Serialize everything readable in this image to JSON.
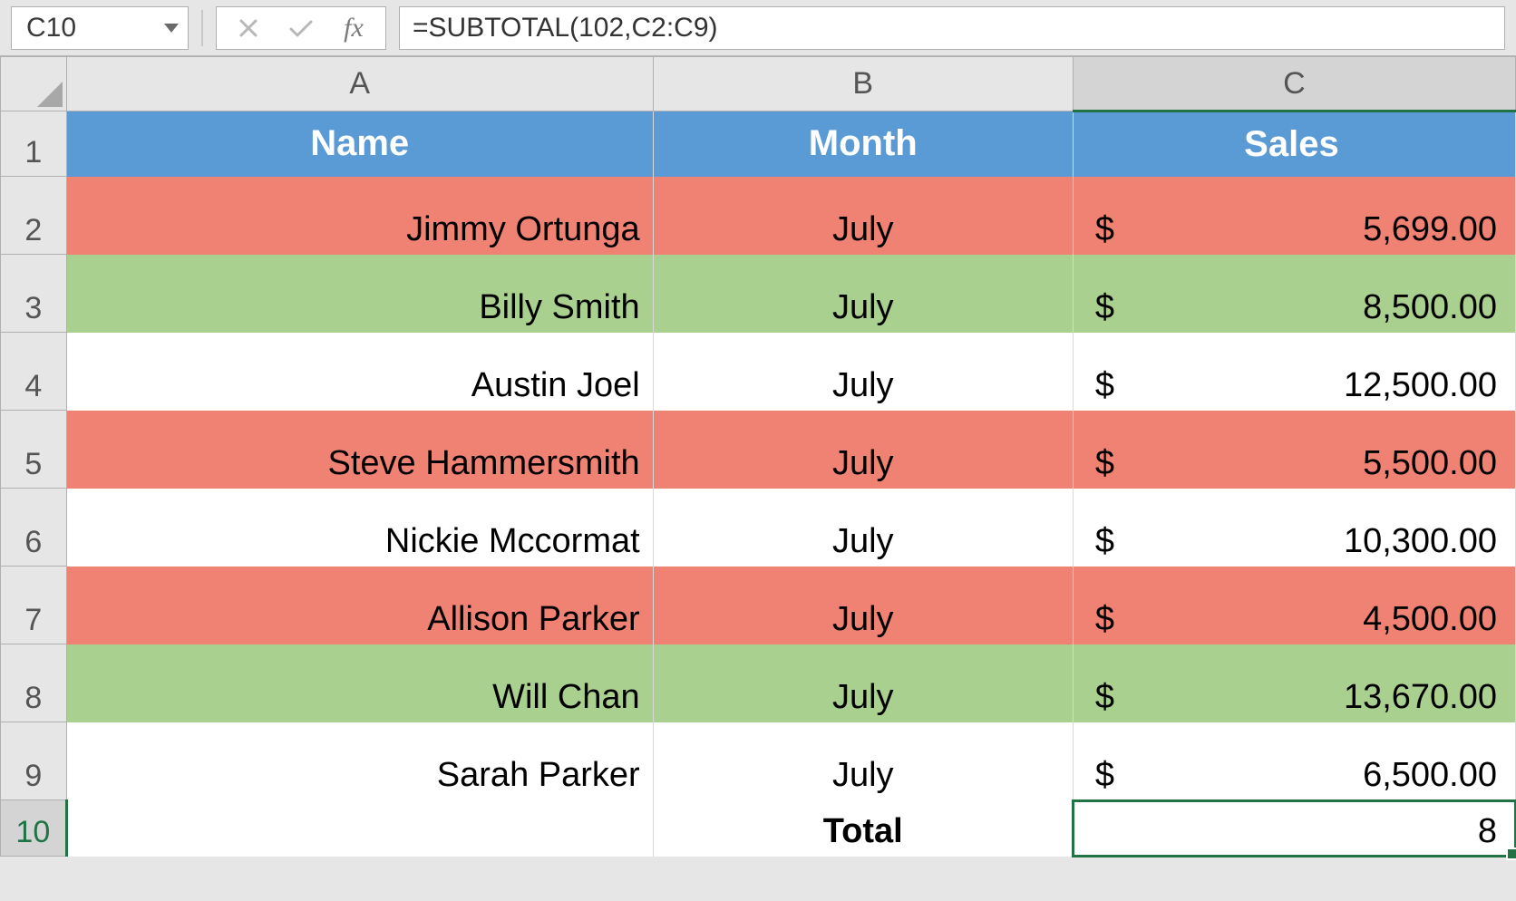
{
  "namebox": {
    "ref": "C10"
  },
  "formula_bar": {
    "fx_label": "fx",
    "formula": "=SUBTOTAL(102,C2:C9)"
  },
  "columns": [
    "A",
    "B",
    "C"
  ],
  "row_numbers": [
    "1",
    "2",
    "3",
    "4",
    "5",
    "6",
    "7",
    "8",
    "9",
    "10"
  ],
  "selected_cell": "C10",
  "table": {
    "headers": {
      "name": "Name",
      "month": "Month",
      "sales": "Sales"
    },
    "rows": [
      {
        "n": "2",
        "name": "Jimmy Ortunga",
        "month": "July",
        "sales": "5,699.00",
        "fill": "red"
      },
      {
        "n": "3",
        "name": "Billy Smith",
        "month": "July",
        "sales": "8,500.00",
        "fill": "green"
      },
      {
        "n": "4",
        "name": "Austin Joel",
        "month": "July",
        "sales": "12,500.00",
        "fill": "white"
      },
      {
        "n": "5",
        "name": "Steve Hammersmith",
        "month": "July",
        "sales": "5,500.00",
        "fill": "red"
      },
      {
        "n": "6",
        "name": "Nickie Mccormat",
        "month": "July",
        "sales": "10,300.00",
        "fill": "white"
      },
      {
        "n": "7",
        "name": "Allison Parker",
        "month": "July",
        "sales": "4,500.00",
        "fill": "red"
      },
      {
        "n": "8",
        "name": "Will Chan",
        "month": "July",
        "sales": "13,670.00",
        "fill": "green"
      },
      {
        "n": "9",
        "name": "Sarah Parker",
        "month": "July",
        "sales": "6,500.00",
        "fill": "white"
      }
    ],
    "total": {
      "label": "Total",
      "value": "8"
    },
    "currency_symbol": "$"
  },
  "colors": {
    "header_blue": "#5b9bd5",
    "fill_red": "#ef8272",
    "fill_green": "#a9d08e",
    "selection_green": "#217346"
  }
}
